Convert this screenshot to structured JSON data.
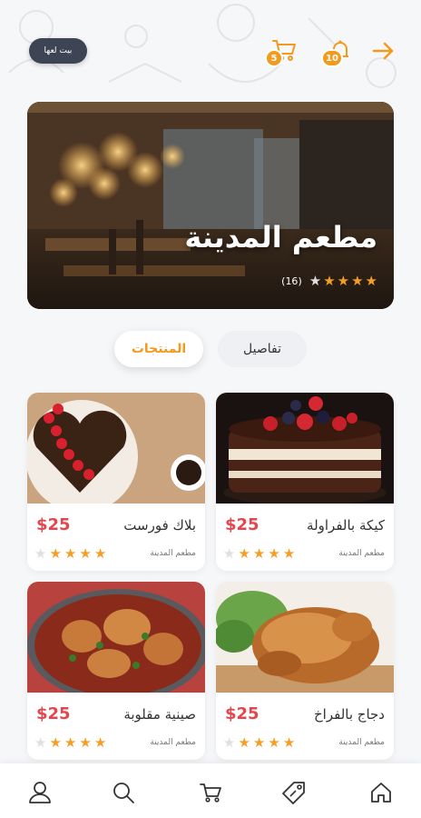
{
  "header": {
    "back_icon": "arrow-right-icon",
    "notifications_count": "10",
    "cart_count": "5",
    "home_pill_label": "بيت لعها"
  },
  "restaurant": {
    "name": "مطعم المدينة",
    "rating": 4,
    "rating_max": 5,
    "reviews_count": "(16)"
  },
  "tabs": [
    {
      "label": "المنتجات",
      "active": true
    },
    {
      "label": "تفاصيل",
      "active": false
    }
  ],
  "products": [
    {
      "name": "كيكة بالفراولة",
      "price": "$25",
      "source": "مطعم المدينة",
      "rating": 4
    },
    {
      "name": "بلاك فورست",
      "price": "$25",
      "source": "مطعم المدينة",
      "rating": 4
    },
    {
      "name": "دجاج بالفراخ",
      "price": "$25",
      "source": "مطعم المدينة",
      "rating": 4
    },
    {
      "name": "صينية مقلوبة",
      "price": "$25",
      "source": "مطعم المدينة",
      "rating": 4
    }
  ],
  "bottom_nav": [
    "home-icon",
    "tag-icon",
    "cart-icon",
    "search-icon",
    "user-icon"
  ],
  "colors": {
    "accent": "#f39a1c",
    "price": "#e6454f",
    "star": "#f5a023"
  }
}
